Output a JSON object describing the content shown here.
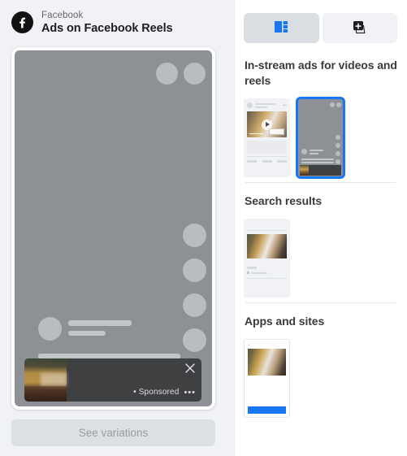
{
  "brand": {
    "logo_icon": "facebook-logo-icon",
    "subtitle": "Facebook",
    "title": "Ads on Facebook Reels"
  },
  "preview": {
    "sponsored_label": "• Sponsored",
    "close_icon": "close-icon",
    "more_icon": "more-options-icon",
    "see_variations_label": "See variations",
    "see_variations_disabled": true,
    "background_color": "#8d9196",
    "sponsored_bar_color": "#3e4042"
  },
  "panel": {
    "tabs": [
      {
        "name": "placements-tab",
        "icon": "layout-placements-icon",
        "active": true
      },
      {
        "name": "media-tab",
        "icon": "add-media-cards-icon",
        "active": false
      }
    ],
    "sections": [
      {
        "title": "In-stream ads for videos and reels",
        "show_divider": false,
        "thumbnails": [
          {
            "name": "thumbnail-in-stream-feed",
            "style": "feed",
            "selected": false
          },
          {
            "name": "thumbnail-in-stream-reels",
            "style": "reel",
            "selected": true
          }
        ]
      },
      {
        "title": "Search results",
        "show_divider": true,
        "thumbnails": [
          {
            "name": "thumbnail-search-results",
            "style": "search",
            "selected": false
          }
        ]
      },
      {
        "title": "Apps and sites",
        "show_divider": true,
        "thumbnails": [
          {
            "name": "thumbnail-apps-and-sites",
            "style": "apps",
            "selected": false
          }
        ]
      }
    ]
  },
  "colors": {
    "accent_blue": "#1877f2",
    "panel_bg": "#f0f2f5",
    "tab_active_bg": "#dadde1",
    "text_primary": "#1c1e21",
    "text_secondary": "#65676b"
  }
}
